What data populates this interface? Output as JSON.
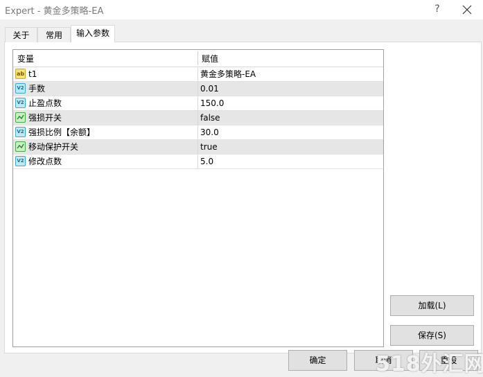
{
  "window": {
    "title": "Expert - 黄金多策略-EA",
    "help_glyph": "?",
    "close_glyph": "✕"
  },
  "tabs": [
    {
      "label": "关于",
      "active": false
    },
    {
      "label": "常用",
      "active": false
    },
    {
      "label": "输入参数",
      "active": true
    }
  ],
  "grid": {
    "columns": [
      "变量",
      "赋值"
    ],
    "rows": [
      {
        "icon": "string-ab-icon",
        "icon_text": "ab",
        "name": "t1",
        "value": "黄金多策略-EA"
      },
      {
        "icon": "numeric-v2-icon",
        "icon_text": "V2",
        "name": "手数",
        "value": "0.01"
      },
      {
        "icon": "numeric-v2-icon",
        "icon_text": "V2",
        "name": "止盈点数",
        "value": "150.0"
      },
      {
        "icon": "boolean-icon",
        "icon_text": "",
        "name": "强损开关",
        "value": "false"
      },
      {
        "icon": "numeric-v2-icon",
        "icon_text": "V2",
        "name": "强损比例【余额】",
        "value": "30.0"
      },
      {
        "icon": "boolean-icon",
        "icon_text": "",
        "name": "移动保护开关",
        "value": "true"
      },
      {
        "icon": "numeric-v2-icon",
        "icon_text": "V2",
        "name": "修改点数",
        "value": "5.0"
      }
    ]
  },
  "side_buttons": {
    "load_label": "加载(L)",
    "save_label": "保存(S)"
  },
  "footer_buttons": {
    "ok_label": "确定",
    "cancel_label": "取消",
    "reset_label": "重设"
  },
  "watermark": "518外汇网"
}
